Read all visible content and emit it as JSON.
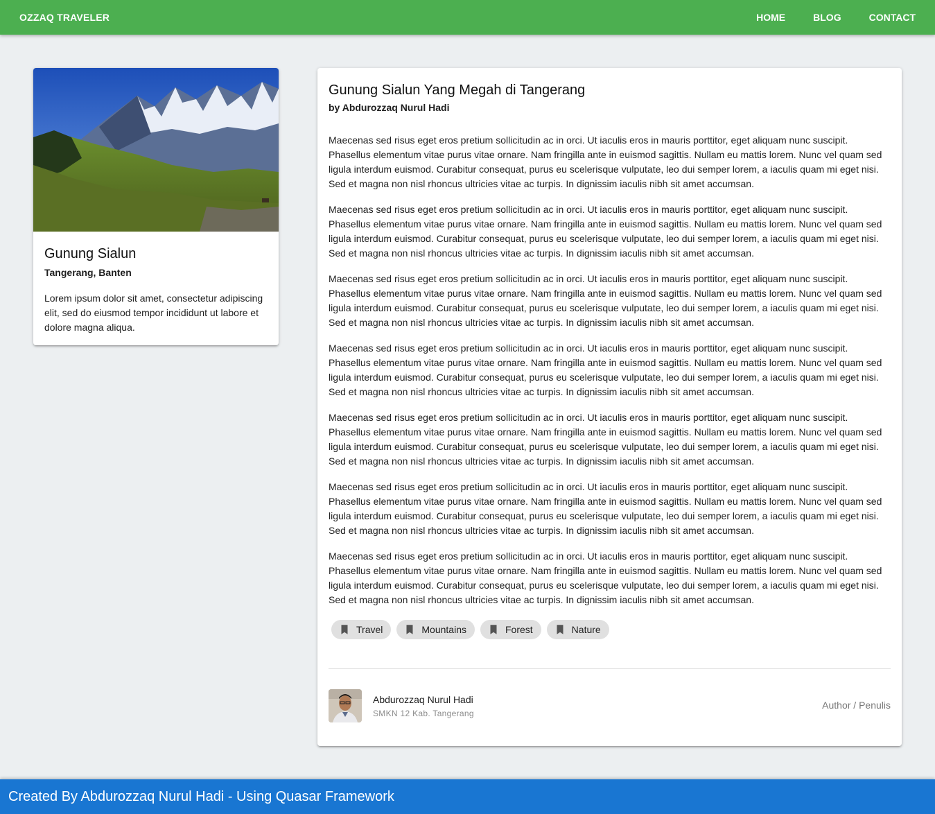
{
  "header": {
    "brand": "OZZAQ TRAVELER",
    "nav": [
      "HOME",
      "BLOG",
      "CONTACT"
    ]
  },
  "side_card": {
    "title": "Gunung Sialun",
    "subtitle": "Tangerang, Banten",
    "text": "Lorem ipsum dolor sit amet, consectetur adipiscing elit, sed do eiusmod tempor incididunt ut labore et dolore magna aliqua."
  },
  "article": {
    "title": "Gunung Sialun Yang Megah di Tangerang",
    "byline": "by Abdurozzaq Nurul Hadi",
    "paragraphs": [
      "Maecenas sed risus eget eros pretium sollicitudin ac in orci. Ut iaculis eros in mauris porttitor, eget aliquam nunc suscipit. Phasellus elementum vitae purus vitae ornare. Nam fringilla ante in euismod sagittis. Nullam eu mattis lorem. Nunc vel quam sed ligula interdum euismod. Curabitur consequat, purus eu scelerisque vulputate, leo dui semper lorem, a iaculis quam mi eget nisi. Sed et magna non nisl rhoncus ultricies vitae ac turpis. In dignissim iaculis nibh sit amet accumsan.",
      "Maecenas sed risus eget eros pretium sollicitudin ac in orci. Ut iaculis eros in mauris porttitor, eget aliquam nunc suscipit. Phasellus elementum vitae purus vitae ornare. Nam fringilla ante in euismod sagittis. Nullam eu mattis lorem. Nunc vel quam sed ligula interdum euismod. Curabitur consequat, purus eu scelerisque vulputate, leo dui semper lorem, a iaculis quam mi eget nisi. Sed et magna non nisl rhoncus ultricies vitae ac turpis. In dignissim iaculis nibh sit amet accumsan.",
      "Maecenas sed risus eget eros pretium sollicitudin ac in orci. Ut iaculis eros in mauris porttitor, eget aliquam nunc suscipit. Phasellus elementum vitae purus vitae ornare. Nam fringilla ante in euismod sagittis. Nullam eu mattis lorem. Nunc vel quam sed ligula interdum euismod. Curabitur consequat, purus eu scelerisque vulputate, leo dui semper lorem, a iaculis quam mi eget nisi. Sed et magna non nisl rhoncus ultricies vitae ac turpis. In dignissim iaculis nibh sit amet accumsan.",
      "Maecenas sed risus eget eros pretium sollicitudin ac in orci. Ut iaculis eros in mauris porttitor, eget aliquam nunc suscipit. Phasellus elementum vitae purus vitae ornare. Nam fringilla ante in euismod sagittis. Nullam eu mattis lorem. Nunc vel quam sed ligula interdum euismod. Curabitur consequat, purus eu scelerisque vulputate, leo dui semper lorem, a iaculis quam mi eget nisi. Sed et magna non nisl rhoncus ultricies vitae ac turpis. In dignissim iaculis nibh sit amet accumsan.",
      "Maecenas sed risus eget eros pretium sollicitudin ac in orci. Ut iaculis eros in mauris porttitor, eget aliquam nunc suscipit. Phasellus elementum vitae purus vitae ornare. Nam fringilla ante in euismod sagittis. Nullam eu mattis lorem. Nunc vel quam sed ligula interdum euismod. Curabitur consequat, purus eu scelerisque vulputate, leo dui semper lorem, a iaculis quam mi eget nisi. Sed et magna non nisl rhoncus ultricies vitae ac turpis. In dignissim iaculis nibh sit amet accumsan.",
      "Maecenas sed risus eget eros pretium sollicitudin ac in orci. Ut iaculis eros in mauris porttitor, eget aliquam nunc suscipit. Phasellus elementum vitae purus vitae ornare. Nam fringilla ante in euismod sagittis. Nullam eu mattis lorem. Nunc vel quam sed ligula interdum euismod. Curabitur consequat, purus eu scelerisque vulputate, leo dui semper lorem, a iaculis quam mi eget nisi. Sed et magna non nisl rhoncus ultricies vitae ac turpis. In dignissim iaculis nibh sit amet accumsan.",
      "Maecenas sed risus eget eros pretium sollicitudin ac in orci. Ut iaculis eros in mauris porttitor, eget aliquam nunc suscipit. Phasellus elementum vitae purus vitae ornare. Nam fringilla ante in euismod sagittis. Nullam eu mattis lorem. Nunc vel quam sed ligula interdum euismod. Curabitur consequat, purus eu scelerisque vulputate, leo dui semper lorem, a iaculis quam mi eget nisi. Sed et magna non nisl rhoncus ultricies vitae ac turpis. In dignissim iaculis nibh sit amet accumsan."
    ],
    "tags": [
      {
        "label": "Travel",
        "icon": "bookmark-icon"
      },
      {
        "label": "Mountains",
        "icon": "bookmark-icon"
      },
      {
        "label": "Forest",
        "icon": "bookmark-icon"
      },
      {
        "label": "Nature",
        "icon": "bookmark-icon"
      }
    ],
    "author": {
      "name": "Abdurozzaq Nurul Hadi",
      "school": "SMKN 12 Kab. Tangerang",
      "role": "Author / Penulis"
    }
  },
  "footer": {
    "text": "Created By Abdurozzaq Nurul Hadi - Using Quasar Framework"
  },
  "colors": {
    "header": "#4caf50",
    "footer": "#1976d2",
    "background": "#eceff1",
    "chip": "#e0e0e0"
  }
}
